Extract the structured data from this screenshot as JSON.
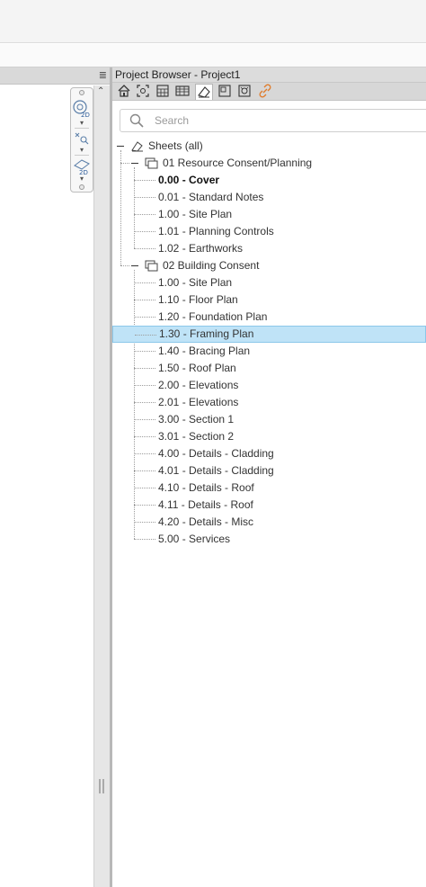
{
  "project_browser": {
    "title": "Project Browser - Project1",
    "search_placeholder": "Search"
  },
  "toolbar": {
    "icons": [
      "home-view-icon",
      "scope-box-icon",
      "schedule-icon",
      "table-icon",
      "sheets-icon",
      "views-icon",
      "families-icon",
      "links-icon"
    ],
    "active": "sheets-icon"
  },
  "tree": {
    "root": "Sheets (all)",
    "groups": [
      {
        "label": "01 Resource Consent/Planning",
        "items": [
          "0.00 - Cover",
          "0.01 - Standard Notes",
          "1.00 - Site Plan",
          "1.01 - Planning Controls",
          "1.02 - Earthworks"
        ]
      },
      {
        "label": "02 Building Consent",
        "items": [
          "1.00 - Site Plan",
          "1.10 - Floor Plan",
          "1.20 - Foundation Plan",
          "1.30 - Framing Plan",
          "1.40 - Bracing Plan",
          "1.50 - Roof Plan",
          "2.00 - Elevations",
          "2.01 - Elevations",
          "3.00 - Section 1",
          "3.01 - Section 2",
          "4.00 - Details - Cladding",
          "4.01 - Details - Cladding",
          "4.10 - Details - Roof",
          "4.11 - Details - Roof",
          "4.20 - Details - Misc",
          "5.00 - Services"
        ]
      }
    ],
    "selected": "1.30 - Framing Plan",
    "bold_item": "0.00 - Cover"
  },
  "colors": {
    "selection_bg": "#bfe3f7",
    "selection_border": "#8cc8ea",
    "link_icon": "#e07b2a",
    "nav_icon": "#5a7ea8"
  }
}
